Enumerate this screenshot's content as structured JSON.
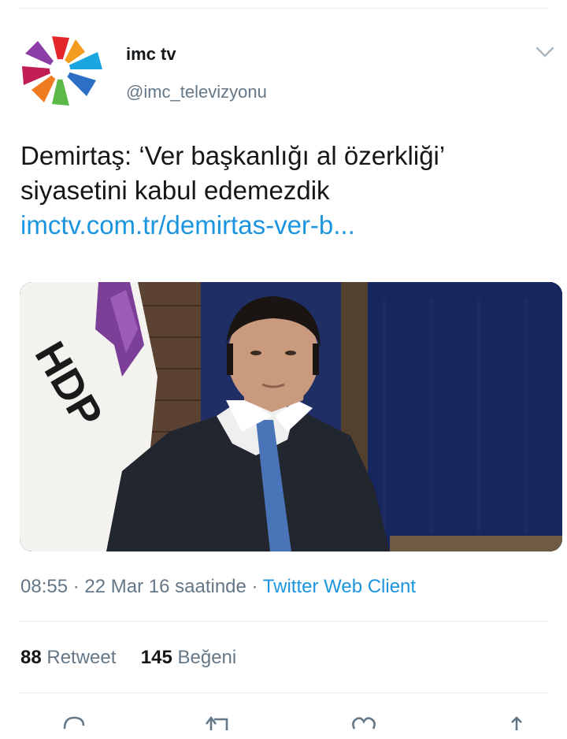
{
  "tweet": {
    "display_name": "imc tv",
    "handle": "@imc_televizyonu",
    "text_line1": "Demirtaş: ‘Ver başkanlığı al özerkliği’",
    "text_line2": "siyasetini kabul edemezdik",
    "link": "imctv.com.tr/demirtas-ver-b...",
    "media_flag_text": "HDP",
    "time": "08:55",
    "date_text": "22 Mar 16 saatinde",
    "separator": "·",
    "source": "Twitter Web Client",
    "retweet_count": "88",
    "retweet_label": "Retweet",
    "like_count": "145",
    "like_label": "Beğeni"
  },
  "icons": {
    "avatar": "imc-tv-logo",
    "menu": "chevron-down-icon",
    "reply": "reply-icon",
    "retweet": "retweet-icon",
    "like": "heart-icon",
    "share": "share-icon"
  },
  "colors": {
    "link": "#1b95e0",
    "secondary_text": "#657786",
    "primary_text": "#14171a",
    "divider": "#e6ecf0",
    "hdp_purple": "#7b3f98"
  }
}
